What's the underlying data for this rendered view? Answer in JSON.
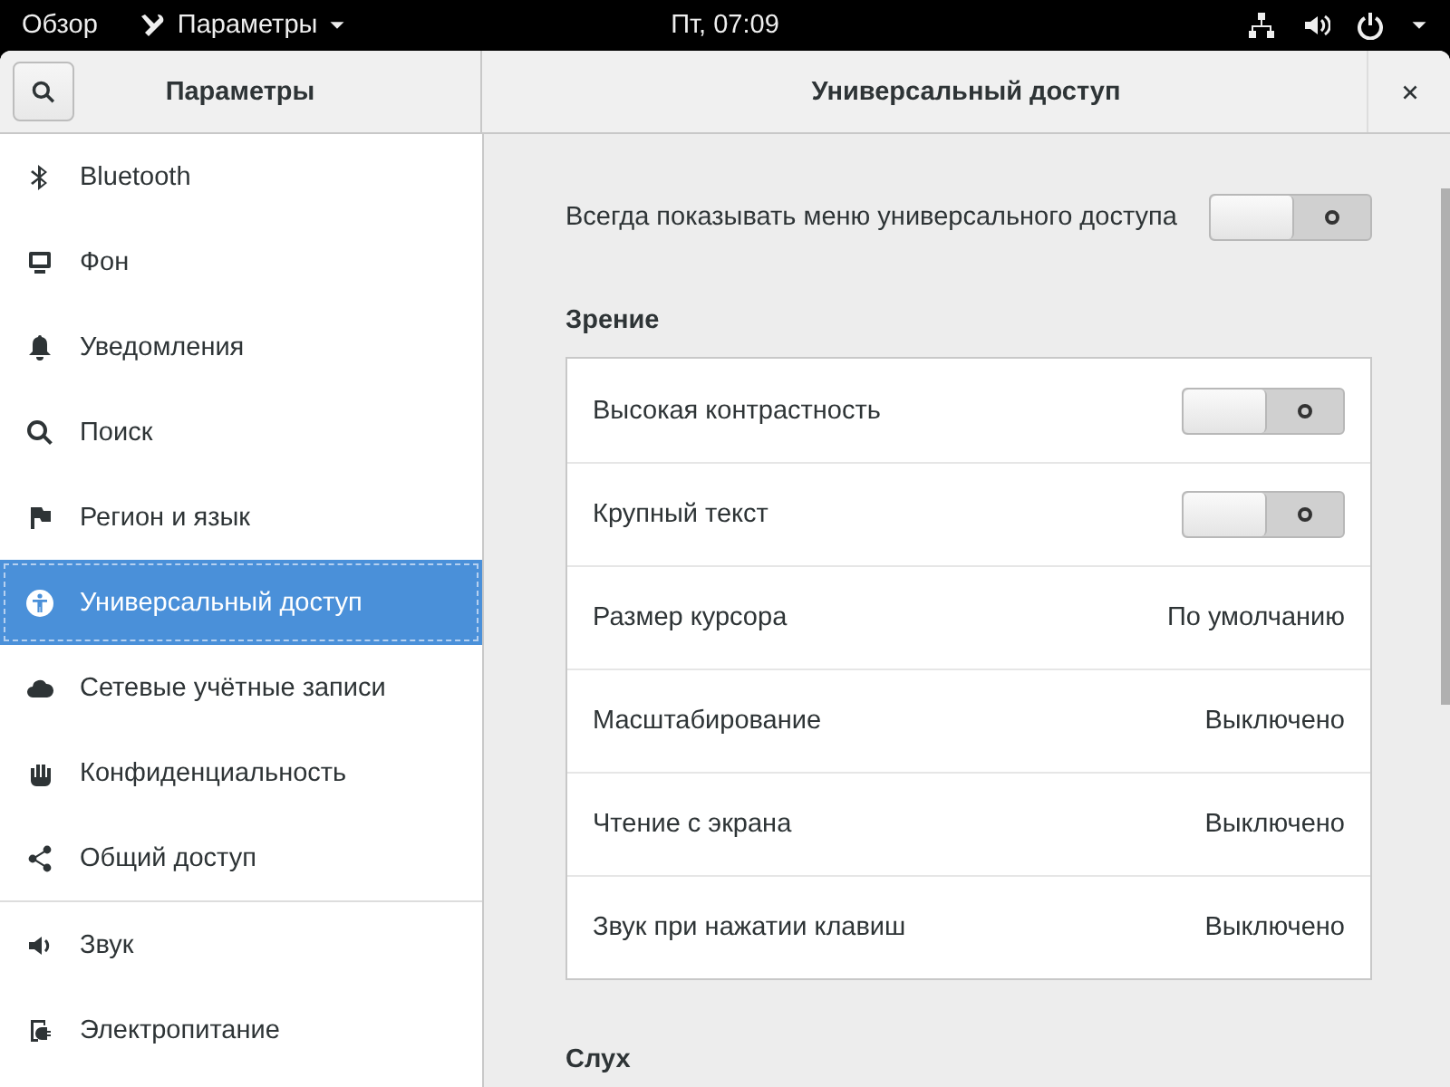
{
  "top_bar": {
    "activities": "Обзор",
    "app_menu": "Параметры",
    "clock": "Пт, 07:09"
  },
  "header": {
    "sidebar_title": "Параметры",
    "title": "Универсальный доступ"
  },
  "sidebar": {
    "items": [
      {
        "label": "Bluetooth",
        "selected": false
      },
      {
        "label": "Фон",
        "selected": false
      },
      {
        "label": "Уведомления",
        "selected": false
      },
      {
        "label": "Поиск",
        "selected": false
      },
      {
        "label": "Регион и язык",
        "selected": false
      },
      {
        "label": "Универсальный доступ",
        "selected": true
      },
      {
        "label": "Сетевые учётные записи",
        "selected": false
      },
      {
        "label": "Конфиденциальность",
        "selected": false
      },
      {
        "label": "Общий доступ",
        "selected": false,
        "separator_after": true
      },
      {
        "label": "Звук",
        "selected": false
      },
      {
        "label": "Электропитание",
        "selected": false
      }
    ]
  },
  "always_show": {
    "label": "Всегда показывать меню универсального доступа",
    "on": false
  },
  "sections": [
    {
      "title": "Зрение",
      "rows": [
        {
          "kind": "switch",
          "label": "Высокая контрастность",
          "on": false
        },
        {
          "kind": "switch",
          "label": "Крупный текст",
          "on": false
        },
        {
          "kind": "value",
          "label": "Размер курсора",
          "value": "По умолчанию"
        },
        {
          "kind": "value",
          "label": "Масштабирование",
          "value": "Выключено"
        },
        {
          "kind": "value",
          "label": "Чтение с экрана",
          "value": "Выключено"
        },
        {
          "kind": "value",
          "label": "Звук при нажатии клавиш",
          "value": "Выключено"
        }
      ]
    },
    {
      "title": "Слух"
    }
  ]
}
